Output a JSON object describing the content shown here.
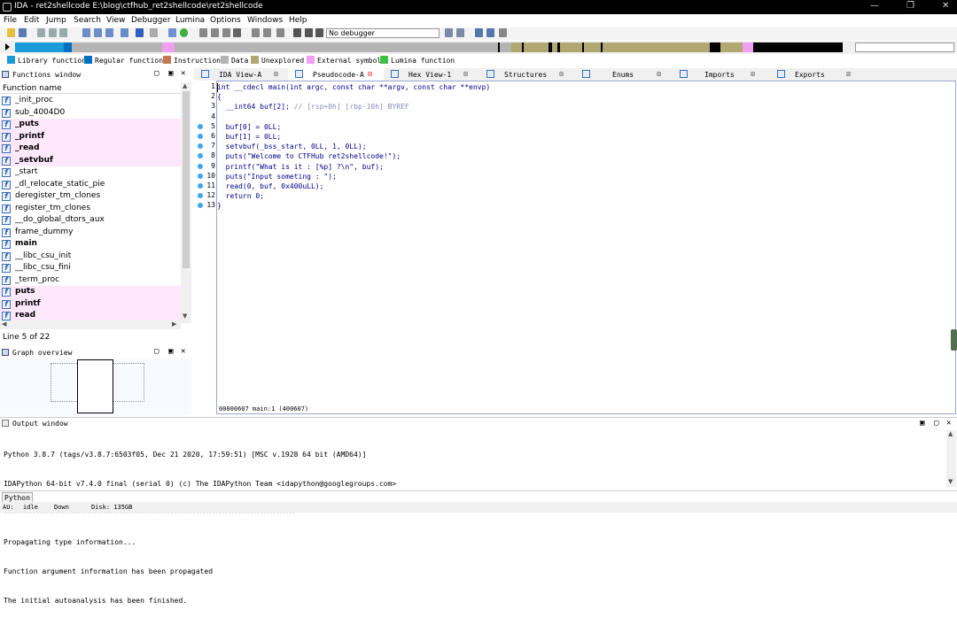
{
  "window": {
    "title": "IDA - ret2shellcode E:\\blog\\ctfhub_ret2shellcode\\ret2shellcode",
    "controls": [
      "—",
      "❐",
      "✕"
    ]
  },
  "menu": [
    "File",
    "Edit",
    "Jump",
    "Search",
    "View",
    "Debugger",
    "Lumina",
    "Options",
    "Windows",
    "Help"
  ],
  "toolbar": {
    "debugger_select": "No debugger"
  },
  "legend": [
    {
      "label": "Library function",
      "color": "#1a9ad6"
    },
    {
      "label": "Regular function",
      "color": "#0070c0"
    },
    {
      "label": "Instruction",
      "color": "#c07850"
    },
    {
      "label": "Data",
      "color": "#b4b4b4"
    },
    {
      "label": "Unexplored",
      "color": "#b0a870"
    },
    {
      "label": "External symbol",
      "color": "#f0a0f0"
    },
    {
      "label": "Lumina function",
      "color": "#40c040"
    }
  ],
  "functions_window": {
    "title": "Functions window",
    "column": "Function name",
    "items": [
      {
        "name": "_init_proc",
        "import": false,
        "bold": false
      },
      {
        "name": "sub_4004D0",
        "import": false,
        "bold": false
      },
      {
        "name": "_puts",
        "import": true,
        "bold": true
      },
      {
        "name": "_printf",
        "import": true,
        "bold": true
      },
      {
        "name": "_read",
        "import": true,
        "bold": true
      },
      {
        "name": "_setvbuf",
        "import": true,
        "bold": true
      },
      {
        "name": "_start",
        "import": false,
        "bold": false
      },
      {
        "name": "_dl_relocate_static_pie",
        "import": false,
        "bold": false
      },
      {
        "name": "deregister_tm_clones",
        "import": false,
        "bold": false
      },
      {
        "name": "register_tm_clones",
        "import": false,
        "bold": false
      },
      {
        "name": "__do_global_dtors_aux",
        "import": false,
        "bold": false
      },
      {
        "name": "frame_dummy",
        "import": false,
        "bold": false
      },
      {
        "name": "main",
        "import": false,
        "bold": true
      },
      {
        "name": "__libc_csu_init",
        "import": false,
        "bold": false
      },
      {
        "name": "__libc_csu_fini",
        "import": false,
        "bold": false
      },
      {
        "name": "_term_proc",
        "import": false,
        "bold": false
      },
      {
        "name": "puts",
        "import": true,
        "bold": true
      },
      {
        "name": "printf",
        "import": true,
        "bold": true
      },
      {
        "name": "read",
        "import": true,
        "bold": true
      }
    ],
    "line_info": "Line 5 of 22"
  },
  "graph_overview": {
    "title": "Graph overview"
  },
  "tabs": [
    {
      "label": "IDA View-A",
      "active": false
    },
    {
      "label": "Pseudocode-A",
      "active": true
    },
    {
      "label": "Hex View-1",
      "active": false
    },
    {
      "label": "Structures",
      "active": false
    },
    {
      "label": "Enums",
      "active": false
    },
    {
      "label": "Imports",
      "active": false
    },
    {
      "label": "Exports",
      "active": false
    }
  ],
  "pseudocode": {
    "lines": [
      {
        "n": "1",
        "dot": false,
        "text": "int __cdecl main(int argc, const char **argv, const char **envp)",
        "comment": ""
      },
      {
        "n": "2",
        "dot": false,
        "text": "{",
        "comment": ""
      },
      {
        "n": "3",
        "dot": false,
        "text": "  __int64 buf[2]; ",
        "comment": "// [rsp+0h] [rbp-10h] BYREF"
      },
      {
        "n": "4",
        "dot": false,
        "text": "",
        "comment": ""
      },
      {
        "n": "5",
        "dot": true,
        "text": "  buf[0] = 0LL;",
        "comment": ""
      },
      {
        "n": "6",
        "dot": true,
        "text": "  buf[1] = 0LL;",
        "comment": ""
      },
      {
        "n": "7",
        "dot": true,
        "text": "  setvbuf(_bss_start, 0LL, 1, 0LL);",
        "comment": ""
      },
      {
        "n": "8",
        "dot": true,
        "text": "  puts(\"Welcome to CTFHub ret2shellcode!\");",
        "comment": ""
      },
      {
        "n": "9",
        "dot": true,
        "text": "  printf(\"What is it : [%p] ?\\n\", buf);",
        "comment": ""
      },
      {
        "n": "10",
        "dot": true,
        "text": "  puts(\"Input someting : \");",
        "comment": ""
      },
      {
        "n": "11",
        "dot": true,
        "text": "  read(0, buf, 0x400uLL);",
        "comment": ""
      },
      {
        "n": "12",
        "dot": true,
        "text": "  return 0;",
        "comment": ""
      },
      {
        "n": "13",
        "dot": true,
        "text": "}",
        "comment": ""
      }
    ],
    "status": "00000607 main:1 (400607)"
  },
  "output_window": {
    "title": "Output window",
    "lines": [
      "Python 3.8.7 (tags/v3.8.7:6503f05, Dec 21 2020, 17:59:51) [MSC v.1928 64 bit (AMD64)]",
      "IDAPython 64-bit v7.4.0 final (serial 0) (c) The IDAPython Team <idapython@googlegroups.com>",
      "-------------------------------------------------------------------------------------------",
      "Propagating type information...",
      "Function argument information has been propagated",
      "The initial autoanalysis has been finished."
    ],
    "python_button": "Python"
  },
  "statusbar": {
    "au_label": "AU:",
    "au_value": "idle",
    "direction": "Down",
    "disk": "Disk: 135GB"
  }
}
